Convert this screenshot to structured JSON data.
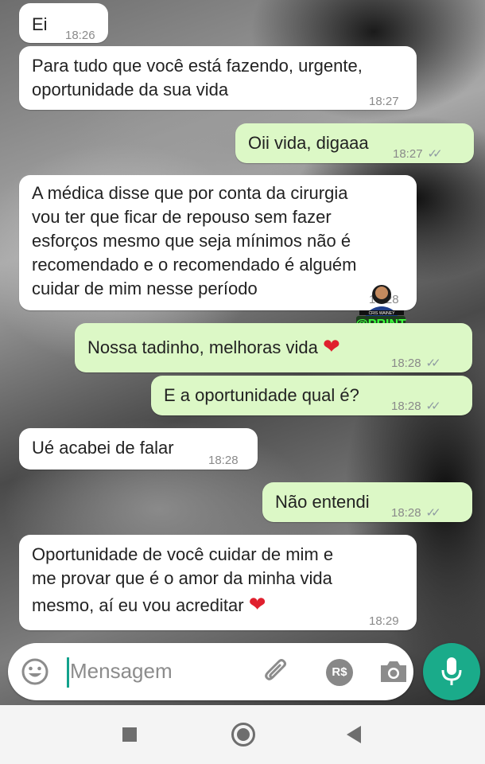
{
  "messages": [
    {
      "lines": [
        "Ei"
      ],
      "time": "18:26"
    },
    {
      "lines": [
        "Para tudo que você está fazendo, urgente,",
        "oportunidade da sua vida"
      ],
      "time": "18:27"
    },
    {
      "lines": [
        "Oii vida, digaaa"
      ],
      "time": "18:27"
    },
    {
      "lines": [
        "A médica disse que por conta da cirurgia",
        "vou ter que ficar de repouso sem fazer",
        "esforços mesmo que seja mínimos não é",
        "recomendado e o recomendado é alguém",
        "cuidar de mim nesse período"
      ],
      "time": "18:28"
    },
    {
      "lines": [
        "Nossa tadinho, melhoras vida"
      ],
      "time": "18:28"
    },
    {
      "lines": [
        "E a oportunidade qual é?"
      ],
      "time": "18:28"
    },
    {
      "lines": [
        "Ué acabei de falar"
      ],
      "time": "18:28"
    },
    {
      "lines": [
        "Não entendi"
      ],
      "time": "18:28"
    },
    {
      "lines": [
        "Oportunidade de você cuidar de mim e",
        "me provar que é o amor da minha vida",
        "mesmo, aí eu vou acreditar"
      ],
      "time": "18:29"
    }
  ],
  "ticks": "✓✓",
  "heart": "❤",
  "watermark": {
    "line1": "CRIS WAINEY",
    "line2": "@PRINT"
  },
  "composer": {
    "placeholder": "Mensagem",
    "rs_label": "R$"
  },
  "colors": {
    "incoming_bubble": "#ffffff",
    "outgoing_bubble": "#dcf8c6",
    "accent": "#1aab8a",
    "read_ticks": "#8f9ba3"
  },
  "icons": [
    "emoji-icon",
    "paperclip-icon",
    "payment-icon",
    "camera-icon",
    "microphone-icon",
    "nav-recents-icon",
    "nav-home-icon",
    "nav-back-icon"
  ]
}
